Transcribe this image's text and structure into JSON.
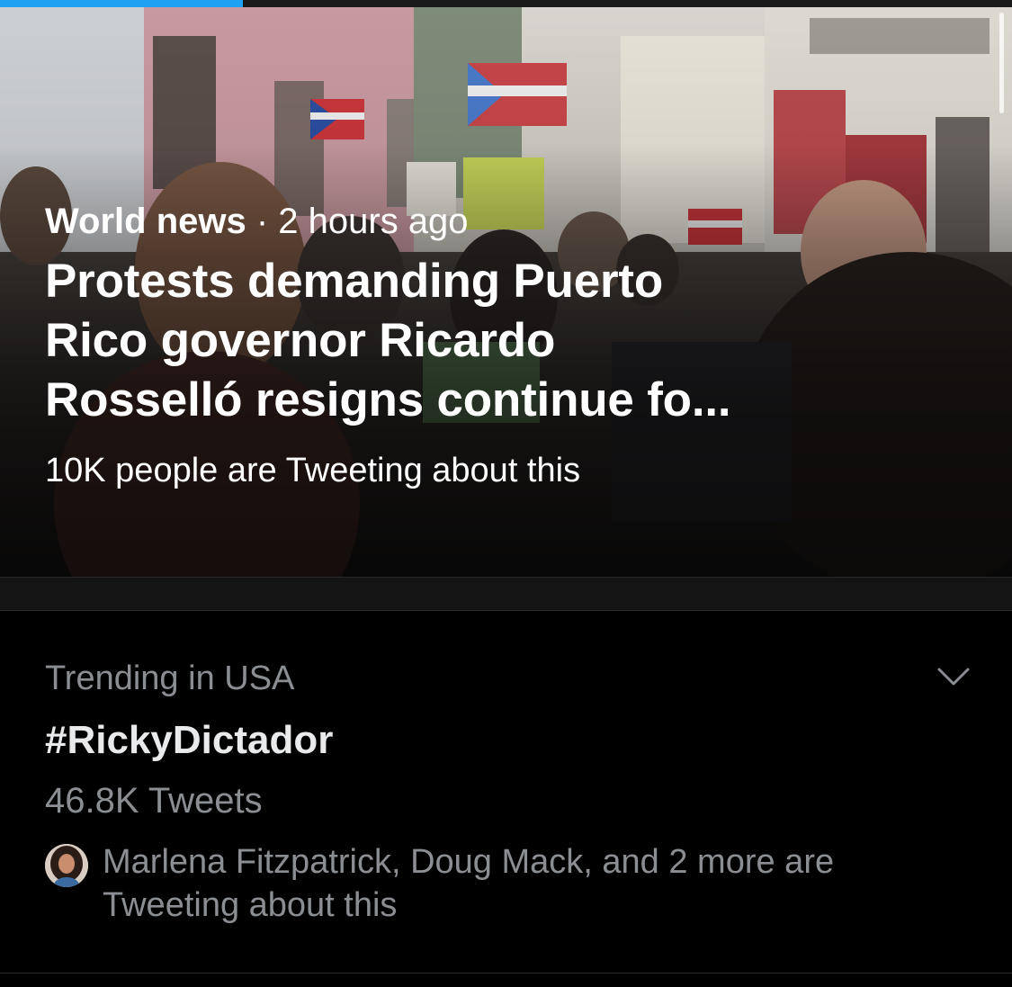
{
  "video": {
    "progress": 0.24
  },
  "hero": {
    "category": "World news",
    "separator": " · ",
    "time": "2 hours ago",
    "headline_lines": [
      "Protests demanding Puerto",
      "Rico governor Ricardo",
      "Rosselló resigns continue fo..."
    ],
    "subtext": "10K people are Tweeting about this"
  },
  "trend": {
    "context": "Trending in USA",
    "name": "#RickyDictador",
    "count": "46.8K Tweets",
    "social_lines": [
      "Marlena Fitzpatrick, Doug Mack, and 2 more are",
      "Tweeting about this"
    ],
    "menu_icon": "chevron-down-icon"
  },
  "colors": {
    "accent": "#1da1f2",
    "secondary_text": "#8b8e92",
    "primary_text": "#e8eaec",
    "background": "#000000"
  }
}
